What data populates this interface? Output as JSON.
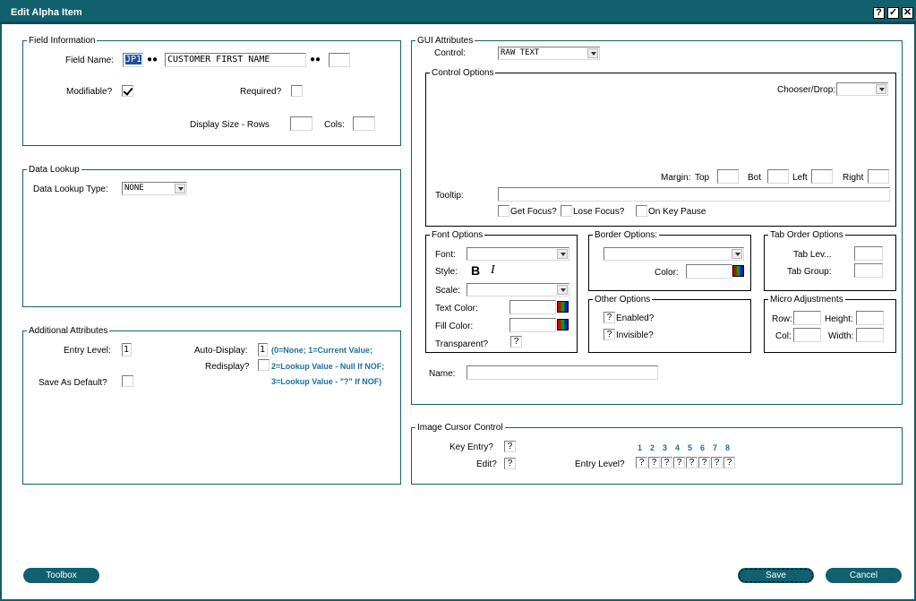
{
  "window": {
    "title": "Edit Alpha Item",
    "help_label": "?",
    "ok_label": "✓",
    "close_label": "✕"
  },
  "field_information": {
    "legend": "Field Information",
    "field_name_label": "Field Name:",
    "field_prefix": "JP1",
    "field_name_value": "CUSTOMER FIRST NAME",
    "field_extra_value": "",
    "modifiable_label": "Modifiable?",
    "modifiable_checked": true,
    "required_label": "Required?",
    "display_size_rows_label": "Display Size - Rows",
    "cols_label": "Cols:"
  },
  "data_lookup": {
    "legend": "Data Lookup",
    "type_label": "Data Lookup Type:",
    "type_value": "NONE"
  },
  "additional_attributes": {
    "legend": "Additional Attributes",
    "entry_level_label": "Entry Level:",
    "entry_level_value": "1",
    "auto_display_label": "Auto-Display:",
    "auto_display_value": "1",
    "redisplay_label": "Redisplay?",
    "save_as_default_label": "Save As Default?",
    "note_line1": "(0=None; 1=Current Value;",
    "note_line2": "2=Lookup Value - Null If NOF;",
    "note_line3": "3=Lookup Value - \"?\" If NOF)"
  },
  "gui_attributes": {
    "legend": "GUI Attributes",
    "control_label": "Control:",
    "control_value": "RAW TEXT",
    "control_options": {
      "legend": "Control Options",
      "chooser_label": "Chooser/Drop:",
      "margin_label": "Margin:",
      "top_label": "Top",
      "bot_label": "Bot",
      "left_label": "Left",
      "right_label": "Right",
      "tooltip_label": "Tooltip:",
      "get_focus_label": "Get Focus?",
      "lose_focus_label": "Lose Focus?",
      "on_key_pause_label": "On Key Pause"
    },
    "font_options": {
      "legend": "Font Options",
      "font_label": "Font:",
      "style_label": "Style:",
      "bold_label": "B",
      "italic_label": "I",
      "scale_label": "Scale:",
      "text_color_label": "Text Color:",
      "fill_color_label": "Fill Color:",
      "transparent_label": "Transparent?",
      "transparent_value": "?"
    },
    "border_options": {
      "legend": "Border Options:",
      "color_label": "Color:"
    },
    "other_options": {
      "legend": "Other Options",
      "enabled_label": "Enabled?",
      "enabled_value": "?",
      "invisible_label": "Invisible?",
      "invisible_value": "?"
    },
    "tab_order_options": {
      "legend": "Tab Order Options",
      "tab_level_label": "Tab Lev...",
      "tab_group_label": "Tab Group:"
    },
    "micro_adjustments": {
      "legend": "Micro Adjustments",
      "row_label": "Row:",
      "height_label": "Height:",
      "col_label": "Col:",
      "width_label": "Width:"
    },
    "name_label": "Name:"
  },
  "image_cursor_control": {
    "legend": "Image Cursor Control",
    "key_entry_label": "Key Entry?",
    "key_entry_value": "?",
    "edit_label": "Edit?",
    "edit_value": "?",
    "entry_level_label": "Entry Level?",
    "level_numbers": [
      "1",
      "2",
      "3",
      "4",
      "5",
      "6",
      "7",
      "8"
    ],
    "level_values": [
      "?",
      "?",
      "?",
      "?",
      "?",
      "?",
      "?",
      "?"
    ]
  },
  "footer": {
    "toolbox_label": "Toolbox",
    "save_label": "Save",
    "cancel_label": "Cancel"
  }
}
